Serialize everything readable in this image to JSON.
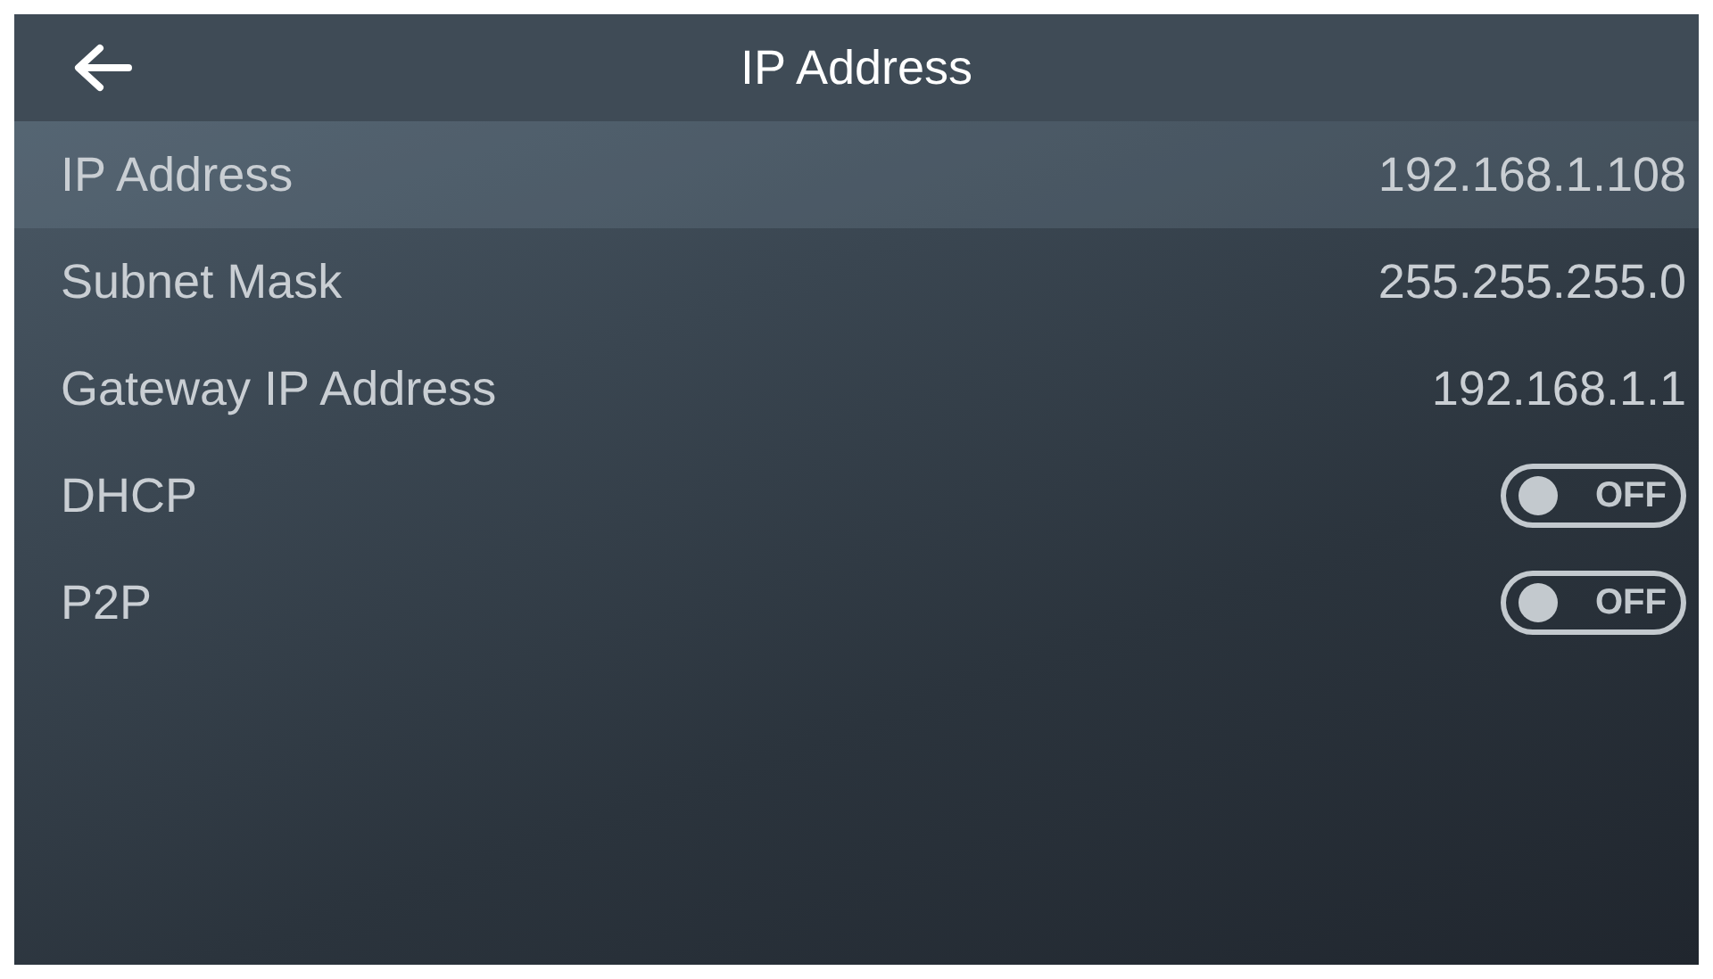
{
  "header": {
    "title": "IP Address"
  },
  "rows": [
    {
      "kind": "value",
      "label": "IP Address",
      "value": "192.168.1.108",
      "selected": true
    },
    {
      "kind": "value",
      "label": "Subnet Mask",
      "value": "255.255.255.0",
      "selected": false
    },
    {
      "kind": "value",
      "label": "Gateway IP Address",
      "value": "192.168.1.1",
      "selected": false
    },
    {
      "kind": "toggle",
      "label": "DHCP",
      "on": false,
      "state_text": "OFF",
      "selected": false
    },
    {
      "kind": "toggle",
      "label": "P2P",
      "on": false,
      "state_text": "OFF",
      "selected": false
    }
  ]
}
